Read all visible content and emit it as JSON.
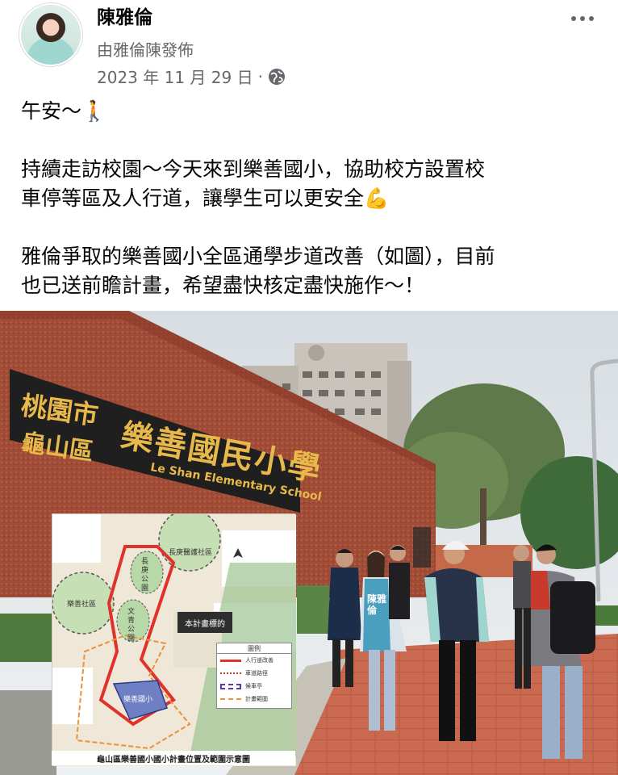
{
  "post": {
    "author": "陳雅倫",
    "byline": "由雅倫陳發佈",
    "date": "2023 年 11 月 29 日",
    "separator": "·",
    "privacy_icon": "globe-icon",
    "more_icon": "more-options-icon",
    "text": {
      "line1": "午安～🚶",
      "line2": "持續走訪校園～今天來到樂善國小，協助校方設置校",
      "line3": "車停等區及人行道，讓學生可以更安全💪",
      "line4": "雅倫爭取的樂善國小全區通學步道改善（如圖），目前",
      "line5": "也已送前瞻計畫，希望盡快核定盡快施作～！"
    }
  },
  "photo": {
    "school_sign": {
      "city": "桃園市",
      "district": "龜山區",
      "name": "樂善國民小學",
      "english": "Le Shan Elementary School"
    },
    "map": {
      "labels": {
        "park_top": "長庚醫護社區",
        "park_left": "樂善社區",
        "park_a": "長庚公園",
        "park_b": "文青公園",
        "school": "樂善國小",
        "target": "本計畫標的"
      },
      "legend": {
        "title": "圖例",
        "items": [
          "人行道改善",
          "車道路徑",
          "候車亭",
          "計畫範圍"
        ]
      },
      "caption": "龜山區樂善國小國小計畫位置及範圍示意圖"
    },
    "vest_text": "陳雅倫"
  },
  "colors": {
    "text_primary": "#050505",
    "text_secondary": "#65676b",
    "brick": "#a8503a",
    "sign": "#1f1f1f",
    "sign_gold": "#e8b84a",
    "route_red": "#e0312b"
  }
}
